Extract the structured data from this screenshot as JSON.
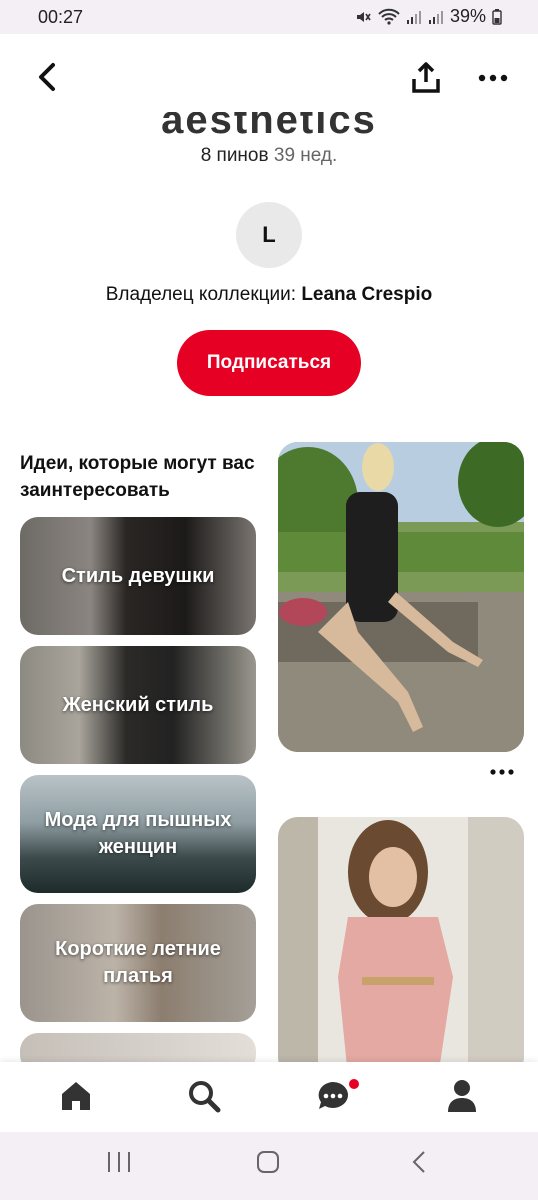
{
  "status_bar": {
    "time": "00:27",
    "battery": "39%"
  },
  "board": {
    "title_partial": "aesthetics",
    "pins_count": "8 пинов",
    "age": "39 нед.",
    "avatar_letter": "L",
    "owner_prefix": "Владелец коллекции: ",
    "owner_name": "Leana Crespio",
    "follow_label": "Подписаться"
  },
  "ideas": {
    "title": "Идеи, которые могут вас заинтересовать",
    "items": [
      {
        "label": "Стиль девушки"
      },
      {
        "label": "Женский стиль"
      },
      {
        "label": "Мода для пышных женщин"
      },
      {
        "label": "Короткие летние платья"
      }
    ]
  },
  "colors": {
    "accent": "#e60023",
    "notification_dot": "#e60023"
  },
  "icons": [
    "back-arrow-icon",
    "share-icon",
    "more-icon",
    "home-icon",
    "search-icon",
    "chat-icon",
    "profile-icon"
  ]
}
